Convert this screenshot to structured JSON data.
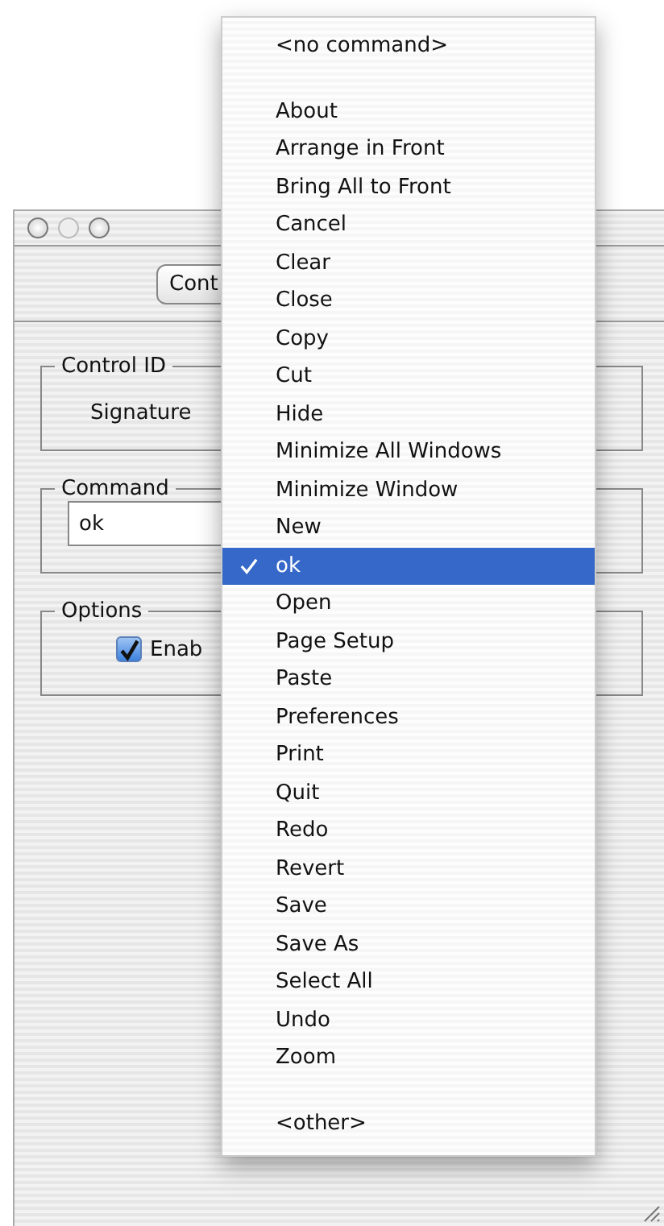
{
  "window": {
    "toolbar_button": "Cont"
  },
  "groups": [
    {
      "kind": "label",
      "legend": "Control ID",
      "text": "Signature"
    },
    {
      "kind": "field",
      "legend": "Command",
      "value": "ok"
    },
    {
      "kind": "checkbox",
      "legend": "Options",
      "text": "Enab",
      "checked": true
    }
  ],
  "menu": {
    "sections": [
      {
        "items": [
          {
            "label": "<no command>",
            "selected": false
          }
        ]
      },
      {
        "items": [
          {
            "label": "About",
            "selected": false
          },
          {
            "label": "Arrange in Front",
            "selected": false
          },
          {
            "label": "Bring All to Front",
            "selected": false
          },
          {
            "label": "Cancel",
            "selected": false
          },
          {
            "label": "Clear",
            "selected": false
          },
          {
            "label": "Close",
            "selected": false
          },
          {
            "label": "Copy",
            "selected": false
          },
          {
            "label": "Cut",
            "selected": false
          },
          {
            "label": "Hide",
            "selected": false
          },
          {
            "label": "Minimize All Windows",
            "selected": false
          },
          {
            "label": "Minimize Window",
            "selected": false
          },
          {
            "label": "New",
            "selected": false
          },
          {
            "label": "ok",
            "selected": true
          },
          {
            "label": "Open",
            "selected": false
          },
          {
            "label": "Page Setup",
            "selected": false
          },
          {
            "label": "Paste",
            "selected": false
          },
          {
            "label": "Preferences",
            "selected": false
          },
          {
            "label": "Print",
            "selected": false
          },
          {
            "label": "Quit",
            "selected": false
          },
          {
            "label": "Redo",
            "selected": false
          },
          {
            "label": "Revert",
            "selected": false
          },
          {
            "label": "Save",
            "selected": false
          },
          {
            "label": "Save As",
            "selected": false
          },
          {
            "label": "Select All",
            "selected": false
          },
          {
            "label": "Undo",
            "selected": false
          },
          {
            "label": "Zoom",
            "selected": false
          }
        ]
      },
      {
        "items": [
          {
            "label": "<other>",
            "selected": false
          }
        ]
      }
    ]
  }
}
